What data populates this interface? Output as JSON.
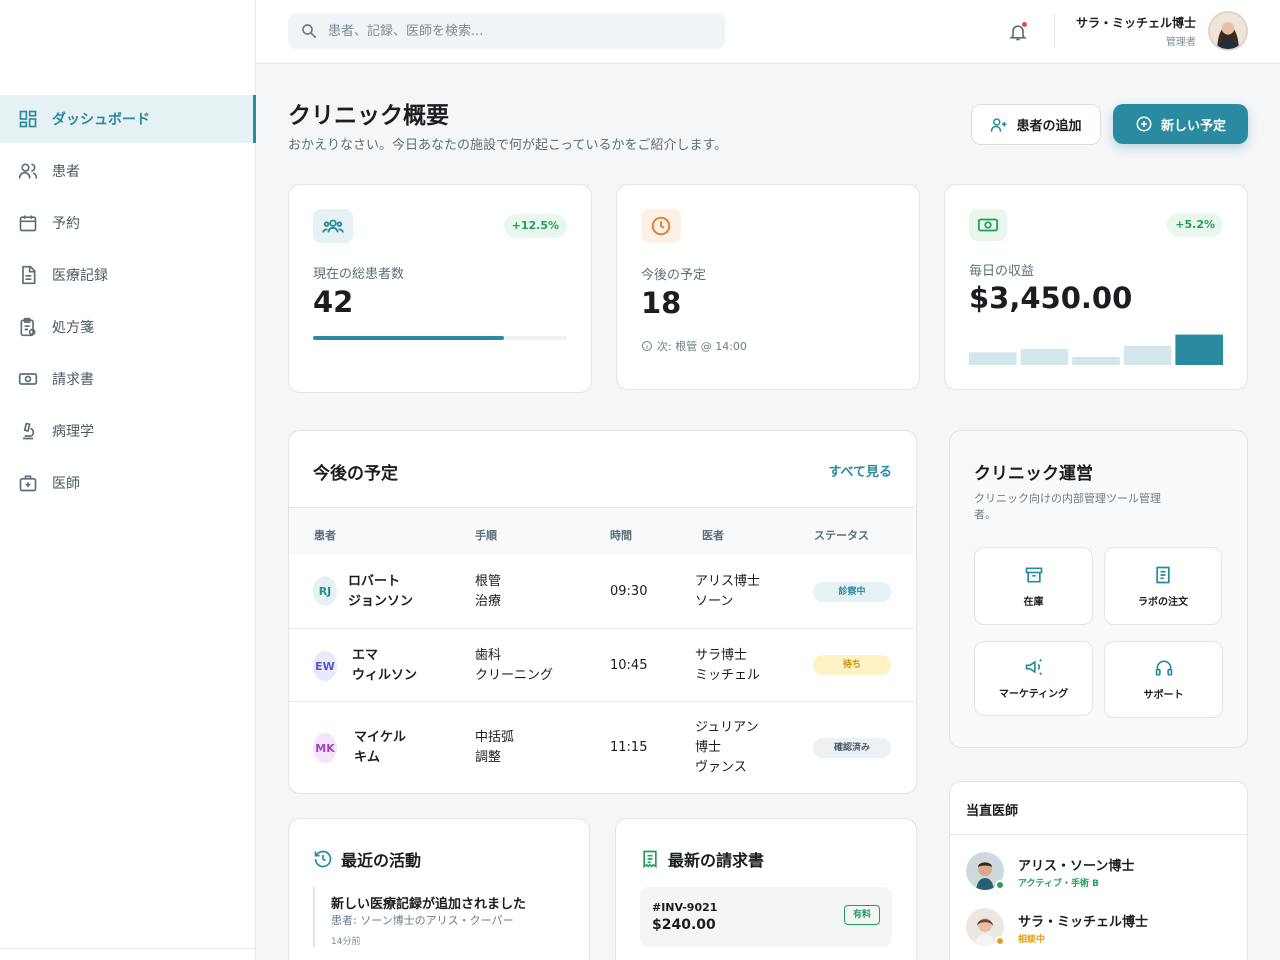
{
  "sidebar": {
    "items": [
      {
        "label": "ダッシュボード",
        "icon": "dashboard-icon",
        "active": true
      },
      {
        "label": "患者",
        "icon": "users-icon"
      },
      {
        "label": "予約",
        "icon": "calendar-icon"
      },
      {
        "label": "医療記録",
        "icon": "document-icon"
      },
      {
        "label": "処方箋",
        "icon": "prescription-icon"
      },
      {
        "label": "請求書",
        "icon": "cash-icon"
      },
      {
        "label": "病理学",
        "icon": "microscope-icon"
      },
      {
        "label": "医師",
        "icon": "medical-kit-icon"
      }
    ]
  },
  "topbar": {
    "search_placeholder": "患者、記録、医師を検索...",
    "user_name": "サラ・ミッチェル博士",
    "user_role": "管理者"
  },
  "header": {
    "title": "クリニック概要",
    "subtitle": "おかえりなさい。今日あなたの施設で何が起こっているかをご紹介します。",
    "add_patient": "患者の追加",
    "new_appointment": "新しい予定"
  },
  "stats": {
    "patients": {
      "label": "現在の総患者数",
      "value": "42",
      "change": "+12.5%",
      "progress": 0.75
    },
    "appointments": {
      "label": "今後の予定",
      "value": "18",
      "next": "次: 根管 @ 14:00"
    },
    "revenue": {
      "label": "毎日の収益",
      "value": "$3,450.00",
      "change": "+5.2%",
      "bars": [
        0.4,
        0.5,
        0.25,
        0.6,
        0.95
      ]
    }
  },
  "colors": {
    "accent": "#2a8aa0",
    "success": "#22a05a",
    "warning": "#e0a020"
  },
  "appointments": {
    "title": "今後の予定",
    "view_all": "すべて見る",
    "headers": [
      "患者",
      "手順",
      "時間",
      "医者",
      "ステータス"
    ],
    "rows": [
      {
        "initials": "RJ",
        "patient": [
          "ロバート",
          "ジョンソン"
        ],
        "procedure": [
          "根管",
          "治療"
        ],
        "time": "09:30",
        "doctor": [
          "アリス博士",
          "ソーン"
        ],
        "status": "診察中",
        "status_type": "active"
      },
      {
        "initials": "EW",
        "patient": [
          "エマ",
          "ウィルソン"
        ],
        "procedure": [
          "歯科",
          "クリーニング"
        ],
        "time": "10:45",
        "doctor": [
          "サラ博士",
          "ミッチェル"
        ],
        "status": "待ち",
        "status_type": "waiting"
      },
      {
        "initials": "MK",
        "patient": [
          "マイケル",
          "キム"
        ],
        "procedure": [
          "中括弧",
          "調整"
        ],
        "time": "11:15",
        "doctor": [
          "ジュリアン",
          "博士",
          "ヴァンス"
        ],
        "status": "確認済み",
        "status_type": "confirmed"
      }
    ]
  },
  "clinic_ops": {
    "title": "クリニック運営",
    "desc": "クリニック向けの内部管理ツール管理者。",
    "tiles": [
      {
        "label": "在庫",
        "icon": "archive-icon"
      },
      {
        "label": "ラボの注文",
        "icon": "lab-order-icon"
      },
      {
        "label": "マーケティング",
        "icon": "megaphone-icon"
      },
      {
        "label": "サポート",
        "icon": "headset-icon"
      }
    ]
  },
  "on_duty": {
    "title": "当直医師",
    "doctors": [
      {
        "name": "アリス・ソーン博士",
        "status": "アクティブ・手術 B"
      },
      {
        "name": "サラ・ミッチェル博士",
        "status": "相談中"
      }
    ]
  },
  "recent_activity": {
    "title": "最近の活動",
    "items": [
      {
        "title": "新しい医療記録が追加されました",
        "sub": "患者: ソーン博士のアリス・クーパー",
        "time": "14分前"
      }
    ]
  },
  "latest_invoice": {
    "title": "最新の請求書",
    "items": [
      {
        "id": "#INV-9021",
        "amount": "$240.00",
        "badge": "有料"
      }
    ]
  }
}
